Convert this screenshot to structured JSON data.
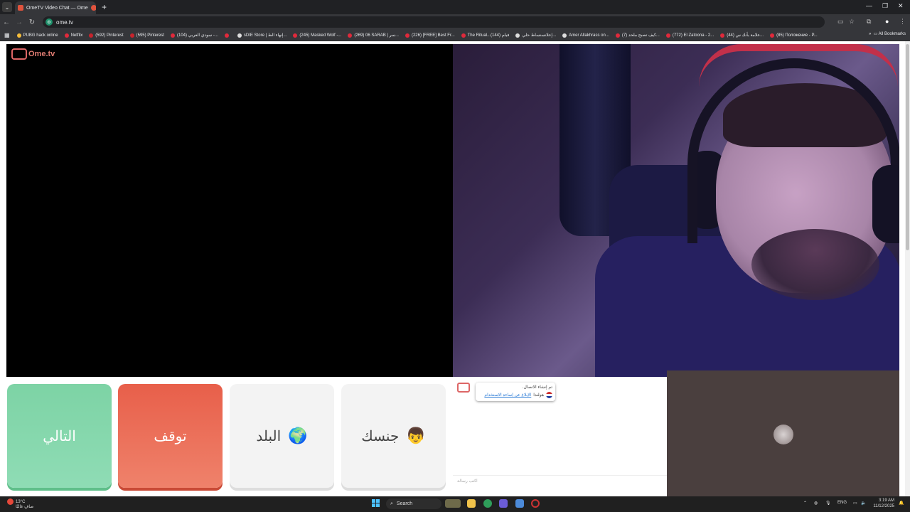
{
  "browser": {
    "tab_title": "OmeTV Video Chat — Ome",
    "url": "ome.tv",
    "bookmarks": [
      {
        "label": "PUBG hack online",
        "icon": "y"
      },
      {
        "label": "Netflix",
        "icon": "p"
      },
      {
        "label": "(592) Pinterest",
        "icon": "p"
      },
      {
        "label": "(595) Pinterest",
        "icon": "p"
      },
      {
        "label": "(104) سودي العربي -...",
        "icon": "r"
      },
      {
        "label": "",
        "icon": "r"
      },
      {
        "label": "sDIE Store | إنهاء الط...",
        "icon": "g"
      },
      {
        "label": "(245) Masked Wolf -...",
        "icon": "r"
      },
      {
        "label": "(269) 06 SARAB | سر...",
        "icon": "r"
      },
      {
        "label": "(226) [FREE] Best Fr...",
        "icon": "r"
      },
      {
        "label": "The Ritual...فيلم (144)",
        "icon": "r"
      },
      {
        "label": "إعلانسنساط حلي...",
        "icon": "g"
      },
      {
        "label": "Amer Allakhrass on...",
        "icon": "g"
      },
      {
        "label": "(7) كيف تصبح ملحد...",
        "icon": "r"
      },
      {
        "label": "(772) El Zatoona - 2...",
        "icon": "r"
      },
      {
        "label": "(44) علامة بأنك س...",
        "icon": "r"
      },
      {
        "label": "(85) Положение - P...",
        "icon": "r"
      }
    ],
    "all_bookmarks": "All Bookmarks"
  },
  "site": {
    "logo_text": "Ome.tv"
  },
  "controls": {
    "next": "التالي",
    "stop": "توقف",
    "country": "البلد",
    "gender": "جنسك"
  },
  "chat": {
    "system_line1": "تم إنشاء الاتصال.",
    "system_line2_prefix": "هولندا",
    "system_link": "الإبلاغ عن إساءة الاستخدام",
    "input_placeholder": "اكتب رسالة"
  },
  "taskbar": {
    "temp": "13°C",
    "weather": "صافٍ غالبًا",
    "search": "Search",
    "lang": "ENG",
    "time": "3:19 AM",
    "date": "11/12/2025"
  },
  "colors": {
    "next": "#7dd3a5",
    "stop": "#e85f4a"
  }
}
